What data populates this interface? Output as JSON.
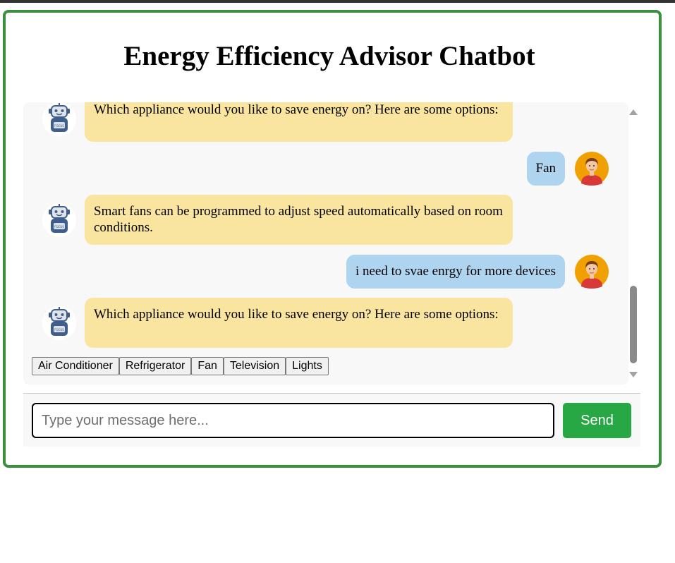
{
  "app": {
    "title": "Energy Efficiency Advisor Chatbot"
  },
  "messages": [
    {
      "sender": "bot",
      "text": "Which appliance would you like to save energy on? Here are some options:"
    },
    {
      "sender": "user",
      "text": "Fan"
    },
    {
      "sender": "bot",
      "text": "Smart fans can be programmed to adjust speed automatically based on room conditions."
    },
    {
      "sender": "user",
      "text": "i need to svae enrgy for more devices"
    },
    {
      "sender": "bot",
      "text": "Which appliance would you like to save energy on? Here are some options:"
    }
  ],
  "options": [
    "Air Conditioner",
    "Refrigerator",
    "Fan",
    "Television",
    "Lights"
  ],
  "composer": {
    "placeholder": "Type your message here...",
    "send_label": "Send"
  },
  "avatars": {
    "bot_icon": "robot-avatar-icon",
    "user_icon": "user-avatar-icon"
  },
  "colors": {
    "frame_border": "#3c8f3c",
    "bot_bubble": "#f9e4a0",
    "user_bubble": "#aed4f0",
    "send_button": "#28a745",
    "user_avatar_bg": "#f0a000"
  }
}
